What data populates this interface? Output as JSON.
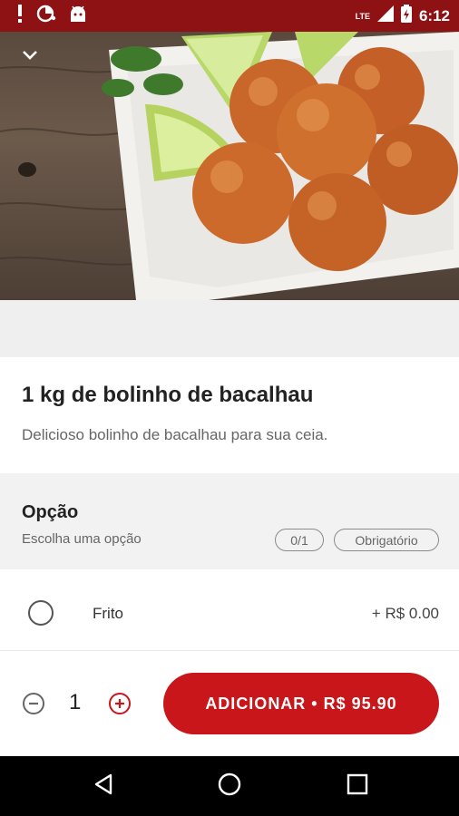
{
  "status_bar": {
    "time": "6:12",
    "network": "LTE",
    "colors": {
      "background": "#8e1114"
    },
    "icons": [
      "alert-icon",
      "pie-status-icon",
      "android-icon",
      "signal-icon",
      "battery-charging-icon"
    ]
  },
  "hero": {
    "image_description": "bolinho-de-bacalhau-photo",
    "icons": [
      "chevron-down-icon"
    ]
  },
  "product": {
    "title": "1 kg de bolinho de bacalhau",
    "description": "Delicioso bolinho de bacalhau para sua ceia."
  },
  "option_group": {
    "title": "Opção",
    "subtitle": "Escolha uma opção",
    "count_badge": "0/1",
    "required_badge": "Obrigatório",
    "options": [
      {
        "label": "Frito",
        "price": "+ R$ 0.00",
        "selected": false
      }
    ]
  },
  "cart": {
    "quantity": "1",
    "add_button_label": "ADICIONAR • R$ 95.90",
    "colors": {
      "accent": "#c8161b"
    },
    "icons": [
      "minus-circle-icon",
      "plus-circle-icon"
    ]
  },
  "nav_bar": {
    "icons": [
      "back-triangle-icon",
      "home-circle-icon",
      "recents-square-icon"
    ]
  }
}
